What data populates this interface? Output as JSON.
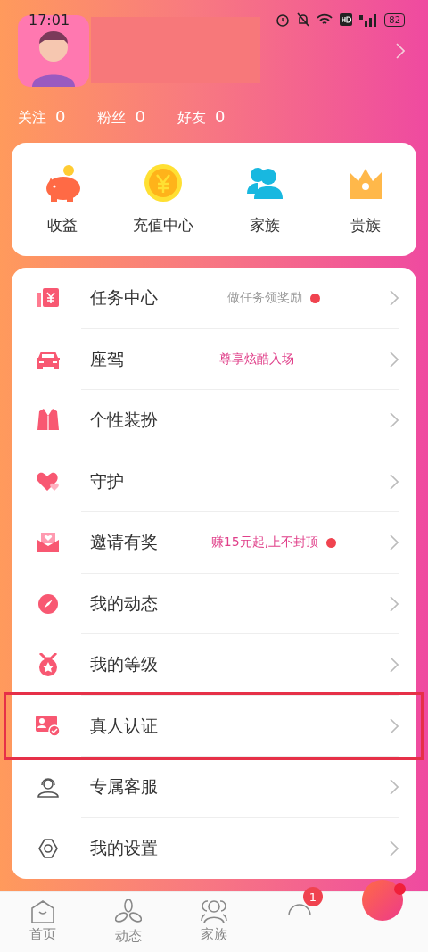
{
  "status_bar": {
    "time": "17:01",
    "battery": "82"
  },
  "profile": {
    "stats": [
      {
        "label": "关注",
        "count": "0"
      },
      {
        "label": "粉丝",
        "count": "0"
      },
      {
        "label": "好友",
        "count": "0"
      }
    ]
  },
  "shortcuts": [
    {
      "kind": "piggy",
      "label": "收益"
    },
    {
      "kind": "coin",
      "label": "充值中心"
    },
    {
      "kind": "people",
      "label": "家族"
    },
    {
      "kind": "crown",
      "label": "贵族"
    }
  ],
  "menu": [
    {
      "kind": "task",
      "label": "任务中心",
      "hint": "做任务领奖励",
      "color": "#9a9a9a",
      "dot": true,
      "highlighted": false
    },
    {
      "kind": "car",
      "label": "座驾",
      "hint": "尊享炫酷入场",
      "color": "#e0408a",
      "dot": false,
      "highlighted": false
    },
    {
      "kind": "suit",
      "label": "个性装扮",
      "dot": false,
      "highlighted": false
    },
    {
      "kind": "heart",
      "label": "守护",
      "dot": false,
      "highlighted": false
    },
    {
      "kind": "gift",
      "label": "邀请有奖",
      "hint": "赚15元起,上不封顶",
      "color": "#e0408a",
      "dot": true,
      "highlighted": false
    },
    {
      "kind": "compass",
      "label": "我的动态",
      "dot": false,
      "highlighted": false
    },
    {
      "kind": "medal",
      "label": "我的等级",
      "dot": false,
      "highlighted": false
    },
    {
      "kind": "idcard",
      "label": "真人认证",
      "dot": false,
      "highlighted": true
    },
    {
      "kind": "agent",
      "label": "专属客服",
      "dot": false,
      "highlighted": false
    },
    {
      "kind": "gear",
      "label": "我的设置",
      "dot": false,
      "highlighted": false
    }
  ],
  "bottom_nav": [
    {
      "kind": "home",
      "label": "首页",
      "selected": false
    },
    {
      "kind": "fan",
      "label": "动态",
      "selected": false
    },
    {
      "kind": "family",
      "label": "家族",
      "selected": false
    },
    {
      "kind": "chat",
      "badge": "1",
      "selected": false
    },
    {
      "kind": "call",
      "dot": true
    }
  ]
}
